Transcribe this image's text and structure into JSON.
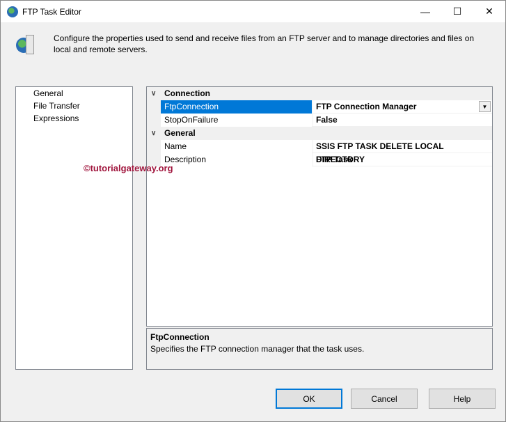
{
  "window": {
    "title": "FTP Task Editor",
    "minimize": "—",
    "maximize": "☐",
    "close": "✕"
  },
  "header": {
    "description": "Configure the properties used to send and receive files from an FTP server and to manage directories and files on local and remote servers."
  },
  "nav": {
    "items": [
      {
        "label": "General"
      },
      {
        "label": "File Transfer"
      },
      {
        "label": "Expressions"
      }
    ]
  },
  "grid": {
    "categories": [
      {
        "label": "Connection",
        "properties": [
          {
            "name": "FtpConnection",
            "value": "FTP Connection Manager"
          },
          {
            "name": "StopOnFailure",
            "value": "False"
          }
        ]
      },
      {
        "label": "General",
        "properties": [
          {
            "name": "Name",
            "value": "SSIS FTP TASK DELETE LOCAL DIRECTORY"
          },
          {
            "name": "Description",
            "value": "FTP Task"
          }
        ]
      }
    ]
  },
  "help": {
    "title": "FtpConnection",
    "text": "Specifies the FTP connection manager that the task uses."
  },
  "watermark": "©tutorialgateway.org",
  "buttons": {
    "ok": "OK",
    "cancel": "Cancel",
    "help": "Help"
  }
}
